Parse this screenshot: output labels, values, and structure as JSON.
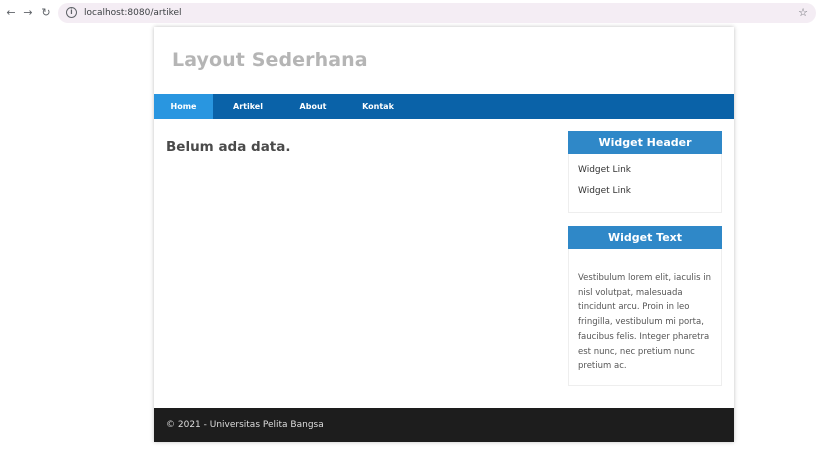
{
  "browser": {
    "back_icon": "arrow-left-icon",
    "forward_icon": "arrow-right-icon",
    "reload_icon": "reload-icon",
    "url": "localhost:8080/artikel",
    "bookmark_icon": "star-icon"
  },
  "header": {
    "title": "Layout Sederhana"
  },
  "nav": {
    "items": [
      {
        "label": "Home",
        "active": true
      },
      {
        "label": "Artikel",
        "active": false
      },
      {
        "label": "About",
        "active": false
      },
      {
        "label": "Kontak",
        "active": false
      }
    ]
  },
  "main": {
    "empty_message": "Belum ada data."
  },
  "sidebar": {
    "widget_header": {
      "title": "Widget Header",
      "links": [
        "Widget Link",
        "Widget Link"
      ]
    },
    "widget_text": {
      "title": "Widget Text",
      "body": "Vestibulum lorem elit, iaculis in nisl volutpat, malesuada tincidunt arcu. Proin in leo fringilla, vestibulum mi porta, faucibus felis. Integer pharetra est nunc, nec pretium nunc pretium ac."
    }
  },
  "footer": {
    "text": "© 2021 - Universitas Pelita Bangsa"
  },
  "colors": {
    "nav_bg": "#0a62a8",
    "nav_active": "#2996e0",
    "widget_header_bg": "#2f88c8",
    "footer_bg": "#1d1d1d"
  }
}
